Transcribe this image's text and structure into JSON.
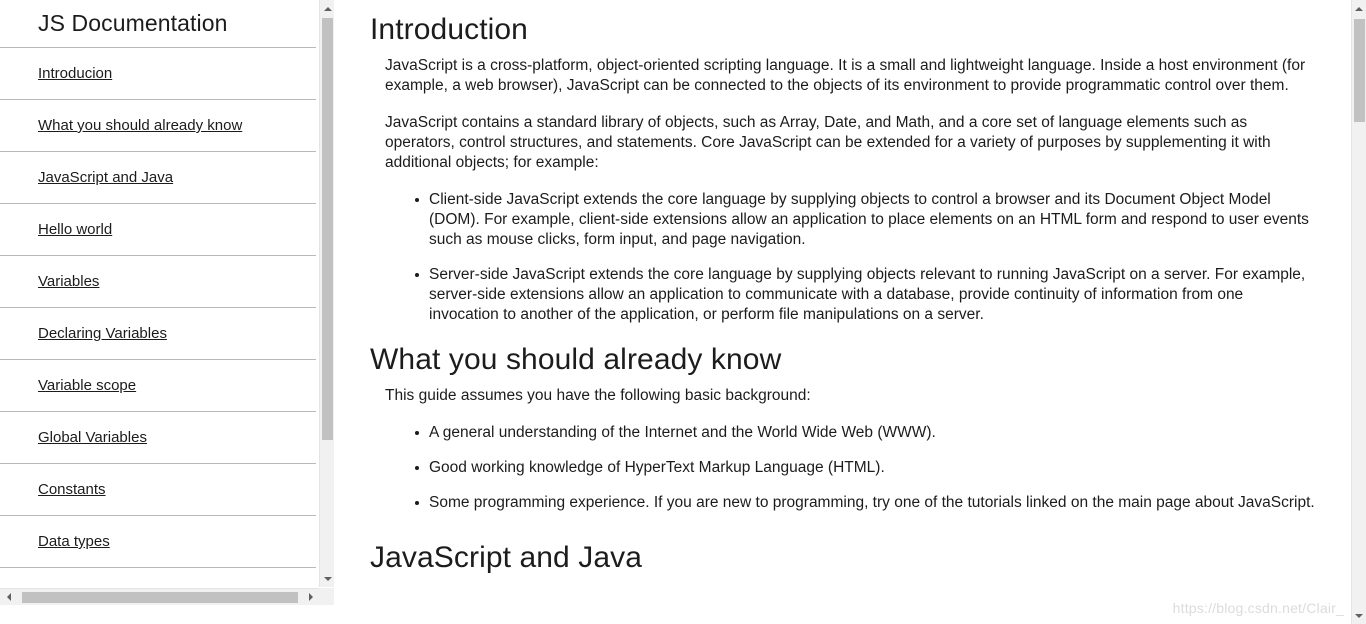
{
  "sidebar": {
    "title": "JS Documentation",
    "items": [
      {
        "label": "Introducion"
      },
      {
        "label": "What you should already know"
      },
      {
        "label": "JavaScript and Java"
      },
      {
        "label": "Hello world"
      },
      {
        "label": "Variables"
      },
      {
        "label": "Declaring Variables"
      },
      {
        "label": "Variable scope"
      },
      {
        "label": "Global Variables"
      },
      {
        "label": "Constants"
      },
      {
        "label": "Data types"
      }
    ],
    "scrollbar": {
      "up_arrow": "▲",
      "down_arrow": "▼",
      "left_arrow": "◀",
      "right_arrow": "▶"
    }
  },
  "main": {
    "sections": [
      {
        "heading": "Introduction",
        "paragraphs": [
          "JavaScript is a cross-platform, object-oriented scripting language. It is a small and lightweight language. Inside a host environment (for example, a web browser), JavaScript can be connected to the objects of its environment to provide programmatic control over them.",
          "JavaScript contains a standard library of objects, such as Array, Date, and Math, and a core set of language elements such as operators, control structures, and statements. Core JavaScript can be extended for a variety of purposes by supplementing it with additional objects; for example:"
        ],
        "bullets": [
          "Client-side JavaScript extends the core language by supplying objects to control a browser and its Document Object Model (DOM). For example, client-side extensions allow an application to place elements on an HTML form and respond to user events such as mouse clicks, form input, and page navigation.",
          "Server-side JavaScript extends the core language by supplying objects relevant to running JavaScript on a server. For example, server-side extensions allow an application to communicate with a database, provide continuity of information from one invocation to another of the application, or perform file manipulations on a server."
        ]
      },
      {
        "heading": "What you should already know",
        "paragraphs": [
          "This guide assumes you have the following basic background:"
        ],
        "bullets": [
          "A general understanding of the Internet and the World Wide Web (WWW).",
          "Good working knowledge of HyperText Markup Language (HTML).",
          "Some programming experience. If you are new to programming, try one of the tutorials linked on the main page about JavaScript."
        ]
      },
      {
        "heading": "JavaScript and Java",
        "paragraphs": [],
        "bullets": []
      }
    ]
  },
  "watermark": {
    "text": "https://blog.csdn.net/Clair_"
  },
  "colors": {
    "background": "#ffffff",
    "text": "#1c1c1c",
    "border": "#b8b8b8",
    "scrollbar_track": "#f1f1f1",
    "scrollbar_thumb": "#c1c1c1",
    "watermark": "#dcdcdc"
  }
}
